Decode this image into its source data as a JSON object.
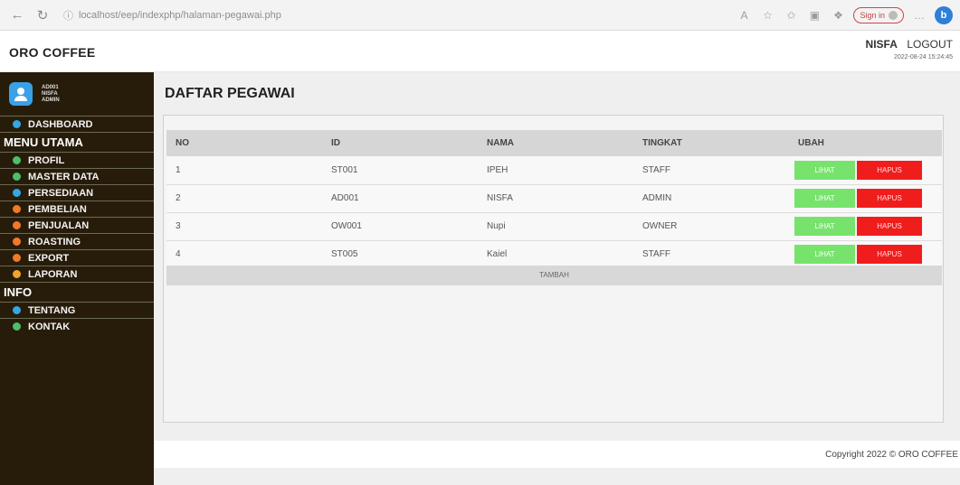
{
  "browser": {
    "url": "localhost/eep/indexphp/halaman-pegawai.php",
    "signin_label": "Sign in"
  },
  "header": {
    "brand": "ORO COFFEE",
    "user": "NISFA",
    "logout": "LOGOUT",
    "timestamp": "2022-08-24 15:24:45"
  },
  "sidebar": {
    "profile": {
      "id": "AD001",
      "name": "NISFA",
      "role": "ADMIN"
    },
    "dashboard": "DASHBOARD",
    "menu_heading": "MENU UTAMA",
    "menu_items": [
      {
        "label": "PROFIL",
        "color": "#4bc06a"
      },
      {
        "label": "MASTER DATA",
        "color": "#4bc06a"
      },
      {
        "label": "PERSEDIAAN",
        "color": "#33a8e6"
      },
      {
        "label": "PEMBELIAN",
        "color": "#f07a28"
      },
      {
        "label": "PENJUALAN",
        "color": "#f07a28"
      },
      {
        "label": "ROASTING",
        "color": "#f07a28"
      },
      {
        "label": "EXPORT",
        "color": "#f07a28"
      },
      {
        "label": "LAPORAN",
        "color": "#f0a52a"
      }
    ],
    "info_heading": "INFO",
    "info_items": [
      {
        "label": "TENTANG",
        "color": "#33a8e6"
      },
      {
        "label": "KONTAK",
        "color": "#4bc06a"
      }
    ]
  },
  "main": {
    "title": "DAFTAR PEGAWAI",
    "columns": [
      "NO",
      "ID",
      "NAMA",
      "TINGKAT",
      "UBAH"
    ],
    "rows": [
      {
        "no": "1",
        "id": "ST001",
        "nama": "IPEH",
        "tingkat": "STAFF"
      },
      {
        "no": "2",
        "id": "AD001",
        "nama": "NISFA",
        "tingkat": "ADMIN"
      },
      {
        "no": "3",
        "id": "OW001",
        "nama": "Nupi",
        "tingkat": "OWNER"
      },
      {
        "no": "4",
        "id": "ST005",
        "nama": "Kaiel",
        "tingkat": "STAFF"
      }
    ],
    "view_label": "LIHAT",
    "delete_label": "HAPUS",
    "add_label": "TAMBAH"
  },
  "footer": {
    "text": "Copyright 2022 © ORO COFFEE"
  },
  "colors": {
    "sidebar_bg": "#271c0a",
    "view_btn": "#77e36d",
    "delete_btn": "#f01d1d"
  }
}
